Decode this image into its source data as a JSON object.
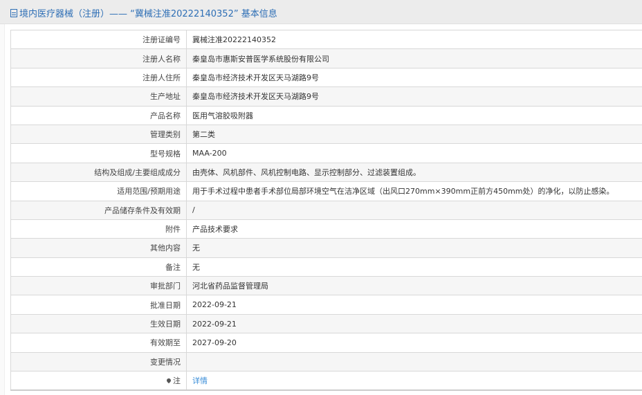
{
  "header": {
    "title": "境内医疗器械（注册）—— “冀械注准20222140352” 基本信息"
  },
  "rows": [
    {
      "label": "注册证编号",
      "value": "冀械注准20222140352"
    },
    {
      "label": "注册人名称",
      "value": "秦皇岛市惠斯安普医学系统股份有限公司"
    },
    {
      "label": "注册人住所",
      "value": "秦皇岛市经济技术开发区天马湖路9号"
    },
    {
      "label": "生产地址",
      "value": "秦皇岛市经济技术开发区天马湖路9号"
    },
    {
      "label": "产品名称",
      "value": "医用气溶胶吸附器"
    },
    {
      "label": "管理类别",
      "value": "第二类"
    },
    {
      "label": "型号规格",
      "value": "MAA-200"
    },
    {
      "label": "结构及组成/主要组成成分",
      "value": "由壳体、风机部件、风机控制电路、显示控制部分、过滤装置组成。"
    },
    {
      "label": "适用范围/预期用途",
      "value": "用于手术过程中患者手术部位局部环境空气在洁净区域（出风口270mm×390mm正前方450mm处）的净化，以防止感染。"
    },
    {
      "label": "产品储存条件及有效期",
      "value": "/"
    },
    {
      "label": "附件",
      "value": "产品技术要求"
    },
    {
      "label": "其他内容",
      "value": "无"
    },
    {
      "label": "备注",
      "value": "无"
    },
    {
      "label": "审批部门",
      "value": "河北省药品监督管理局"
    },
    {
      "label": "批准日期",
      "value": "2022-09-21"
    },
    {
      "label": "生效日期",
      "value": "2022-09-21"
    },
    {
      "label": "有效期至",
      "value": "2027-09-20"
    },
    {
      "label": "变更情况",
      "value": ""
    }
  ],
  "note": {
    "label": "注",
    "link": "详情"
  }
}
